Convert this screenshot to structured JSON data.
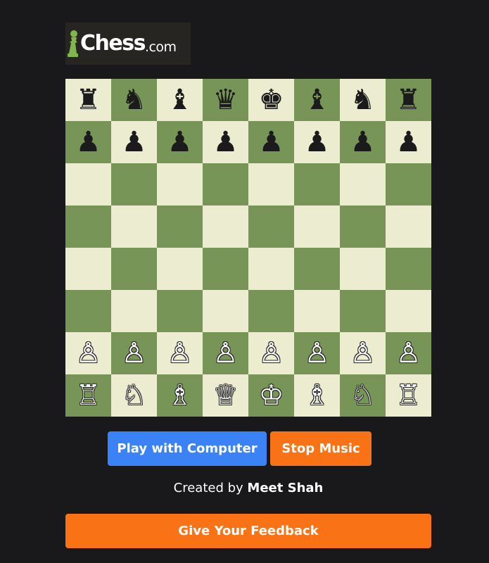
{
  "logo": {
    "text_main": "Chess",
    "text_domain": ".com",
    "colors": {
      "background": "#262522",
      "pawn": "#81b64c",
      "text": "#ffffff"
    }
  },
  "board": {
    "rows": [
      [
        "♜",
        "♞",
        "♝",
        "♛",
        "♚",
        "♝",
        "♞",
        "♜"
      ],
      [
        "♟",
        "♟",
        "♟",
        "♟",
        "♟",
        "♟",
        "♟",
        "♟"
      ],
      [
        "",
        "",
        "",
        "",
        "",
        "",
        "",
        ""
      ],
      [
        "",
        "",
        "",
        "",
        "",
        "",
        "",
        ""
      ],
      [
        "",
        "",
        "",
        "",
        "",
        "",
        "",
        ""
      ],
      [
        "",
        "",
        "",
        "",
        "",
        "",
        "",
        ""
      ],
      [
        "♙",
        "♙",
        "♙",
        "♙",
        "♙",
        "♙",
        "♙",
        "♙"
      ],
      [
        "♖",
        "♘",
        "♗",
        "♕",
        "♔",
        "♗",
        "♘",
        "♖"
      ]
    ],
    "colors": {
      "light": "#ebecd0",
      "dark": "#779556"
    }
  },
  "controls": {
    "play_label": "Play with Computer",
    "music_label": "Stop Music",
    "feedback_label": "Give Your Feedback"
  },
  "credit": {
    "prefix": "Created by ",
    "author": "Meet Shah"
  },
  "colors": {
    "page_bg": "#19181b",
    "play_button": "#3b82f6",
    "orange_button": "#f97316"
  }
}
